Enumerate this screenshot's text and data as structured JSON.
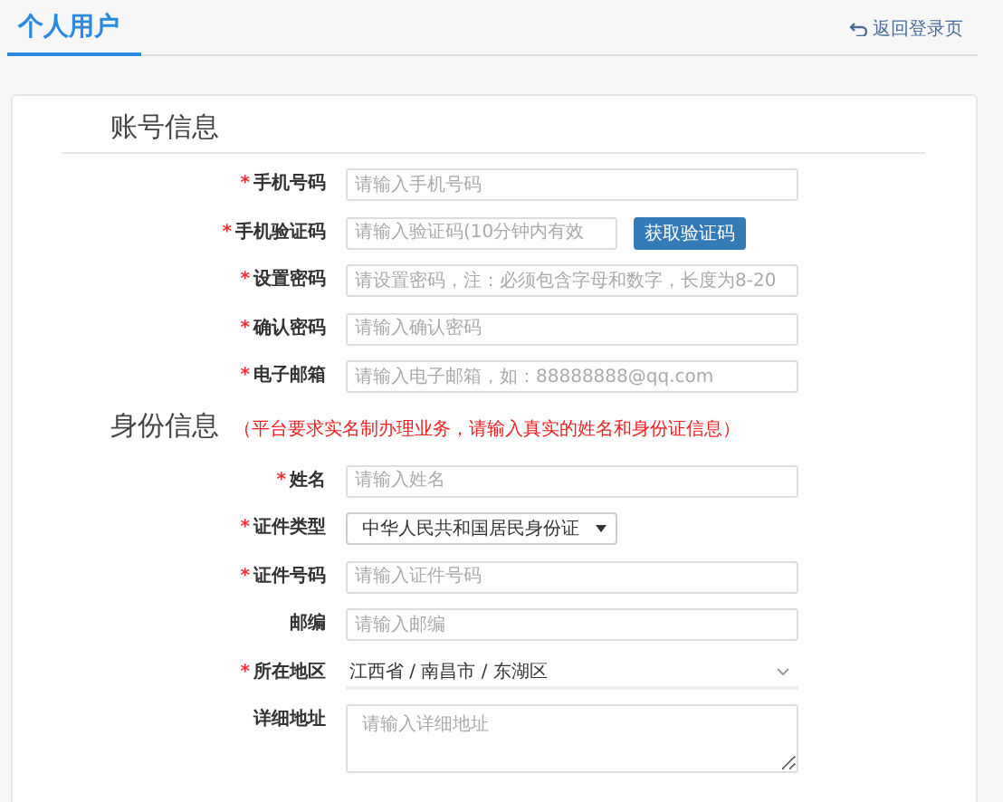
{
  "tabs": [
    {
      "label": "个人用户",
      "selected": true
    }
  ],
  "back_link": "返回登录页",
  "required_mark": "*",
  "sections": [
    {
      "title": "账号信息",
      "fields": [
        {
          "kind": "text",
          "label": "手机号码",
          "required": true,
          "placeholder": "请输入手机号码"
        },
        {
          "kind": "code",
          "label": "手机验证码",
          "required": true,
          "placeholder": "请输入验证码(10分钟内有效",
          "button": "获取验证码"
        },
        {
          "kind": "text",
          "label": "设置密码",
          "required": true,
          "placeholder": "请设置密码，注：必须包含字母和数字，长度为8-20"
        },
        {
          "kind": "text",
          "label": "确认密码",
          "required": true,
          "placeholder": "请输入确认密码"
        },
        {
          "kind": "text",
          "label": "电子邮箱",
          "required": true,
          "placeholder": "请输入电子邮箱，如：88888888@qq.com"
        }
      ]
    },
    {
      "title": "身份信息",
      "note": "（平台要求实名制办理业务，请输入真实的姓名和身份证信息）",
      "fields": [
        {
          "kind": "text",
          "label": "姓名",
          "required": true,
          "placeholder": "请输入姓名"
        },
        {
          "kind": "select",
          "label": "证件类型",
          "required": true,
          "value": "中华人民共和国居民身份证"
        },
        {
          "kind": "text",
          "label": "证件号码",
          "required": true,
          "placeholder": "请输入证件号码"
        },
        {
          "kind": "text",
          "label": "邮编",
          "required": false,
          "placeholder": "请输入邮编"
        },
        {
          "kind": "cascader",
          "label": "所在地区",
          "required": true,
          "value": "江西省 / 南昌市 / 东湖区"
        },
        {
          "kind": "textarea",
          "label": "详细地址",
          "required": false,
          "placeholder": "请输入详细地址"
        }
      ]
    }
  ]
}
